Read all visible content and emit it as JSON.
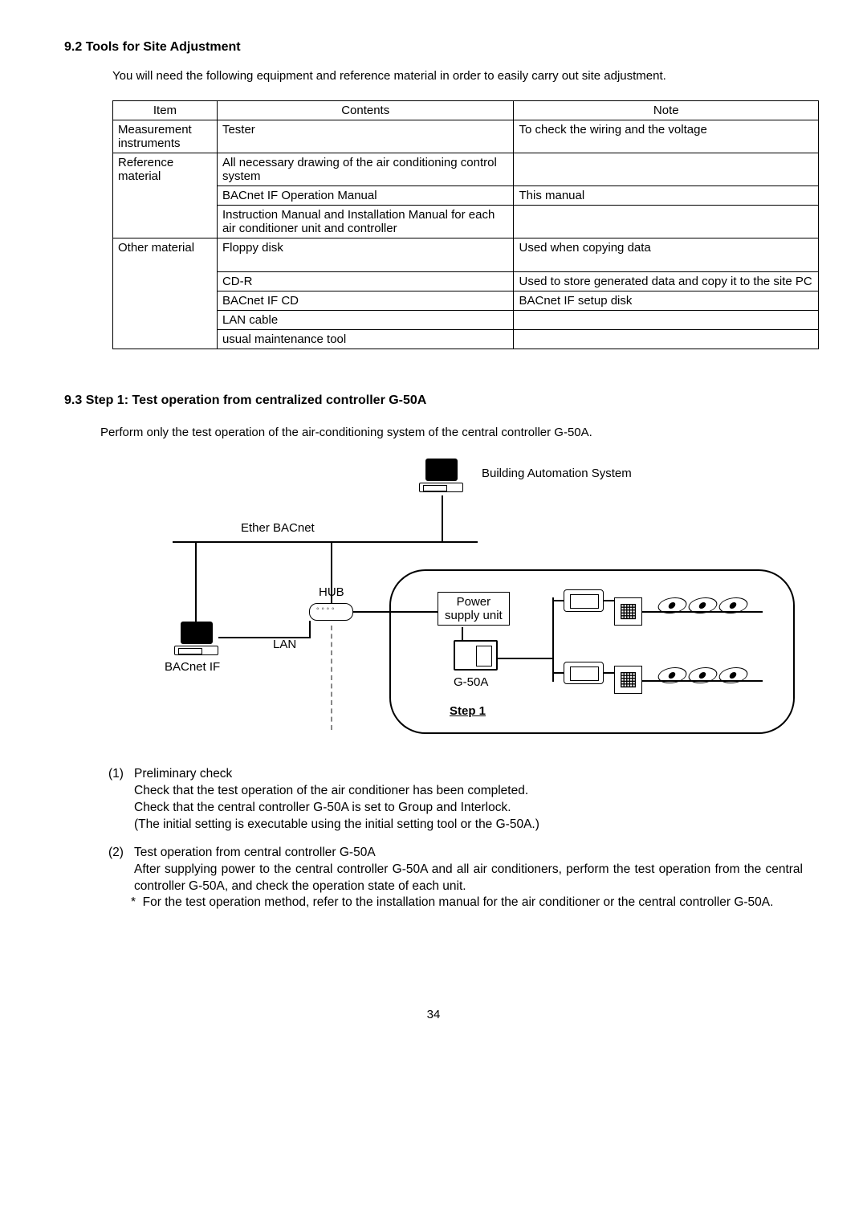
{
  "section_9_2": {
    "heading": "9.2 Tools for Site Adjustment",
    "intro": "You will need the following equipment and reference material in order to easily carry out site adjustment.",
    "table": {
      "headers": {
        "item": "Item",
        "contents": "Contents",
        "note": "Note"
      },
      "rows": [
        {
          "item": "Measurement instruments",
          "contents": "Tester",
          "note": "To check the wiring and the voltage"
        },
        {
          "item": "Reference material",
          "contents": "All necessary drawing of the air conditioning control system",
          "note": ""
        },
        {
          "item": "",
          "contents": "BACnet IF Operation Manual",
          "note": "This manual"
        },
        {
          "item": "",
          "contents": "Instruction Manual and Installation Manual for each air conditioner unit and controller",
          "note": ""
        },
        {
          "item": "Other material",
          "contents": "Floppy disk",
          "note": "Used when copying data"
        },
        {
          "item": "",
          "contents": "CD-R",
          "note": "Used to store generated data and copy it to the site PC"
        },
        {
          "item": "",
          "contents": "BACnet IF CD",
          "note": "BACnet IF setup disk"
        },
        {
          "item": "",
          "contents": "LAN cable",
          "note": ""
        },
        {
          "item": "",
          "contents": "usual maintenance tool",
          "note": ""
        }
      ]
    }
  },
  "section_9_3": {
    "heading": "9.3 Step 1: Test operation from centralized controller G-50A",
    "perform": "Perform only the test operation of the air-conditioning system of the central controller G-50A.",
    "diagram": {
      "bas_label": "Building Automation System",
      "ether_label": "Ether BACnet",
      "hub_label": "HUB",
      "lan_label": "LAN",
      "bacnetif_label": "BACnet IF",
      "power_label1": "Power",
      "power_label2": "supply unit",
      "g50a_label": "G-50A",
      "step1_label": "Step 1"
    },
    "body": {
      "item1_marker": "(1)",
      "item1_head": "Preliminary check",
      "item1_line1": "Check that the test operation of the air conditioner has been completed.",
      "item1_line2": "Check that the central controller G-50A is set to Group and Interlock.",
      "item1_line3": "(The initial setting is executable using the initial setting tool or the G-50A.)",
      "item2_marker": "(2)",
      "item2_head": "Test operation from central controller G-50A",
      "item2_line1": "After supplying power to the central controller G-50A and all air conditioners, perform the test operation from the central controller G-50A, and check the operation state of each unit.",
      "item2_star_marker": "*",
      "item2_star_text": "For the test operation method, refer to the installation manual for the air conditioner or the central controller G-50A."
    }
  },
  "page_number": "34"
}
